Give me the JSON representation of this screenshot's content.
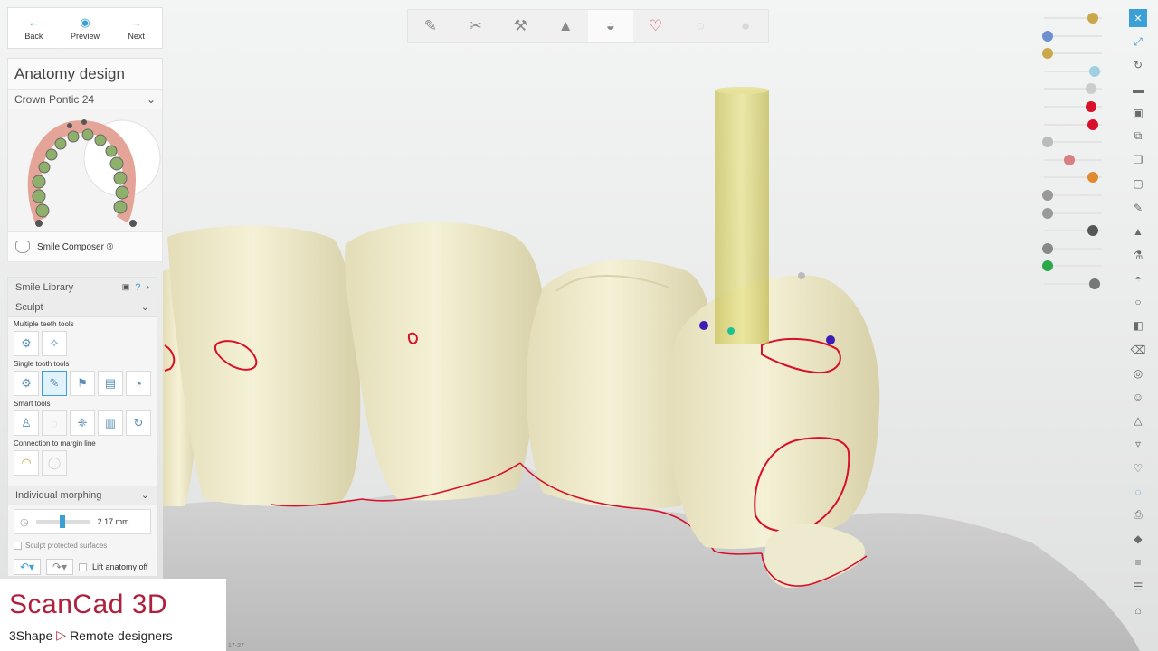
{
  "nav": {
    "back": "Back",
    "preview": "Preview",
    "next": "Next"
  },
  "panel": {
    "title": "Anatomy design",
    "tooth_select": "Crown Pontic 24",
    "smile_composer": "Smile Composer ®"
  },
  "tools": {
    "smile_library": "Smile Library",
    "help_glyph": "?",
    "sculpt": "Sculpt",
    "multiple_teeth": "Multiple teeth tools",
    "single_tooth": "Single tooth tools",
    "smart": "Smart tools",
    "connection_margin": "Connection to margin line",
    "individual_morphing": "Individual morphing",
    "morph_value": "2.17 mm",
    "sculpt_protected": "Sculpt protected surfaces",
    "lift_anatomy": "Lift anatomy off"
  },
  "brand": {
    "name": "ScanCad 3D",
    "company": "3Shape",
    "tagline": "Remote designers"
  },
  "version_fragment": "17-27",
  "icons": {
    "top_toolbar": [
      "pen-icon",
      "scissors-icon",
      "tools-icon",
      "cone-icon",
      "crown-icon",
      "gum-icon",
      "tooth-icon",
      "sphere-icon"
    ],
    "right": [
      "close-icon",
      "fit-icon",
      "rotate-icon",
      "cap-icon",
      "cube-icon",
      "layers-icon",
      "copy-icon",
      "frame-icon",
      "brush-icon",
      "stamp-icon",
      "flask-icon",
      "hat-icon",
      "tooth-icon",
      "cross-section-icon",
      "bracket-icon",
      "globe-icon",
      "face-icon",
      "cone-icon",
      "down-icon",
      "heart-icon",
      "blob-icon",
      "printer-icon",
      "diamond-icon",
      "lines-icon",
      "bars-icon",
      "chair-icon"
    ]
  },
  "colors": {
    "accent": "#3aa0d6",
    "brand": "#b0203c",
    "tooth": "#f1eccb",
    "gum": "#cbcbcb",
    "margin_line": "#d8102a",
    "cylinder": "#ddd773"
  }
}
